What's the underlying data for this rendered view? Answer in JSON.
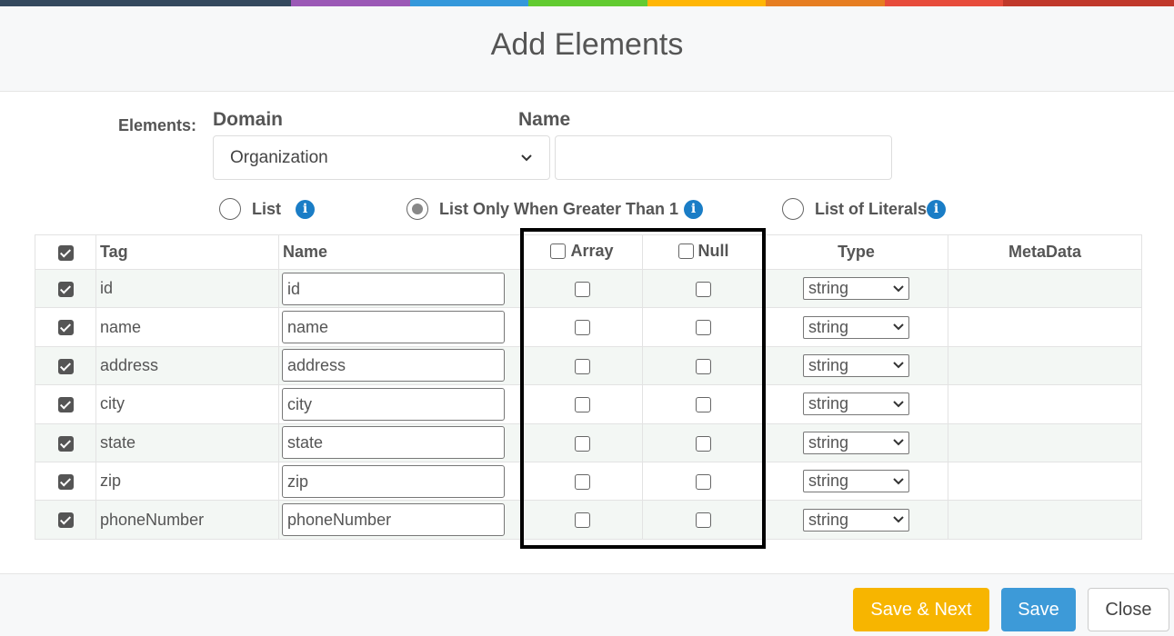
{
  "stripe_colors": [
    "#34495e",
    "#9b59b6",
    "#3498db",
    "#62cb31",
    "#ffb606",
    "#e67e22",
    "#e74c3c",
    "#c0392b"
  ],
  "dialog": {
    "title": "Add Elements"
  },
  "form": {
    "elements_label": "Elements:",
    "domain_label": "Domain",
    "domain_value": "Organization",
    "name_label": "Name",
    "name_value": ""
  },
  "list_options": [
    {
      "label": "List",
      "checked": false,
      "info": true
    },
    {
      "label": "List Only When Greater Than 1",
      "checked": true,
      "info": true
    },
    {
      "label": "List of Literals",
      "checked": false,
      "info": true
    }
  ],
  "table": {
    "headers": {
      "tag": "Tag",
      "name": "Name",
      "array": "Array",
      "null": "Null",
      "type": "Type",
      "metadata": "MetaData"
    },
    "header_all_checked": true,
    "rows": [
      {
        "checked": true,
        "tag": "id",
        "name": "id",
        "array": false,
        "null": false,
        "type": "string",
        "metadata": ""
      },
      {
        "checked": true,
        "tag": "name",
        "name": "name",
        "array": false,
        "null": false,
        "type": "string",
        "metadata": ""
      },
      {
        "checked": true,
        "tag": "address",
        "name": "address",
        "array": false,
        "null": false,
        "type": "string",
        "metadata": ""
      },
      {
        "checked": true,
        "tag": "city",
        "name": "city",
        "array": false,
        "null": false,
        "type": "string",
        "metadata": ""
      },
      {
        "checked": true,
        "tag": "state",
        "name": "state",
        "array": false,
        "null": false,
        "type": "string",
        "metadata": ""
      },
      {
        "checked": true,
        "tag": "zip",
        "name": "zip",
        "array": false,
        "null": false,
        "type": "string",
        "metadata": ""
      },
      {
        "checked": true,
        "tag": "phoneNumber",
        "name": "phoneNumber",
        "array": false,
        "null": false,
        "type": "string",
        "metadata": ""
      }
    ]
  },
  "footer": {
    "save_next_label": "Save & Next",
    "save_label": "Save",
    "close_label": "Close"
  },
  "icons": {
    "info": "info-circle-icon",
    "dropdown": "chevron-down-icon"
  }
}
